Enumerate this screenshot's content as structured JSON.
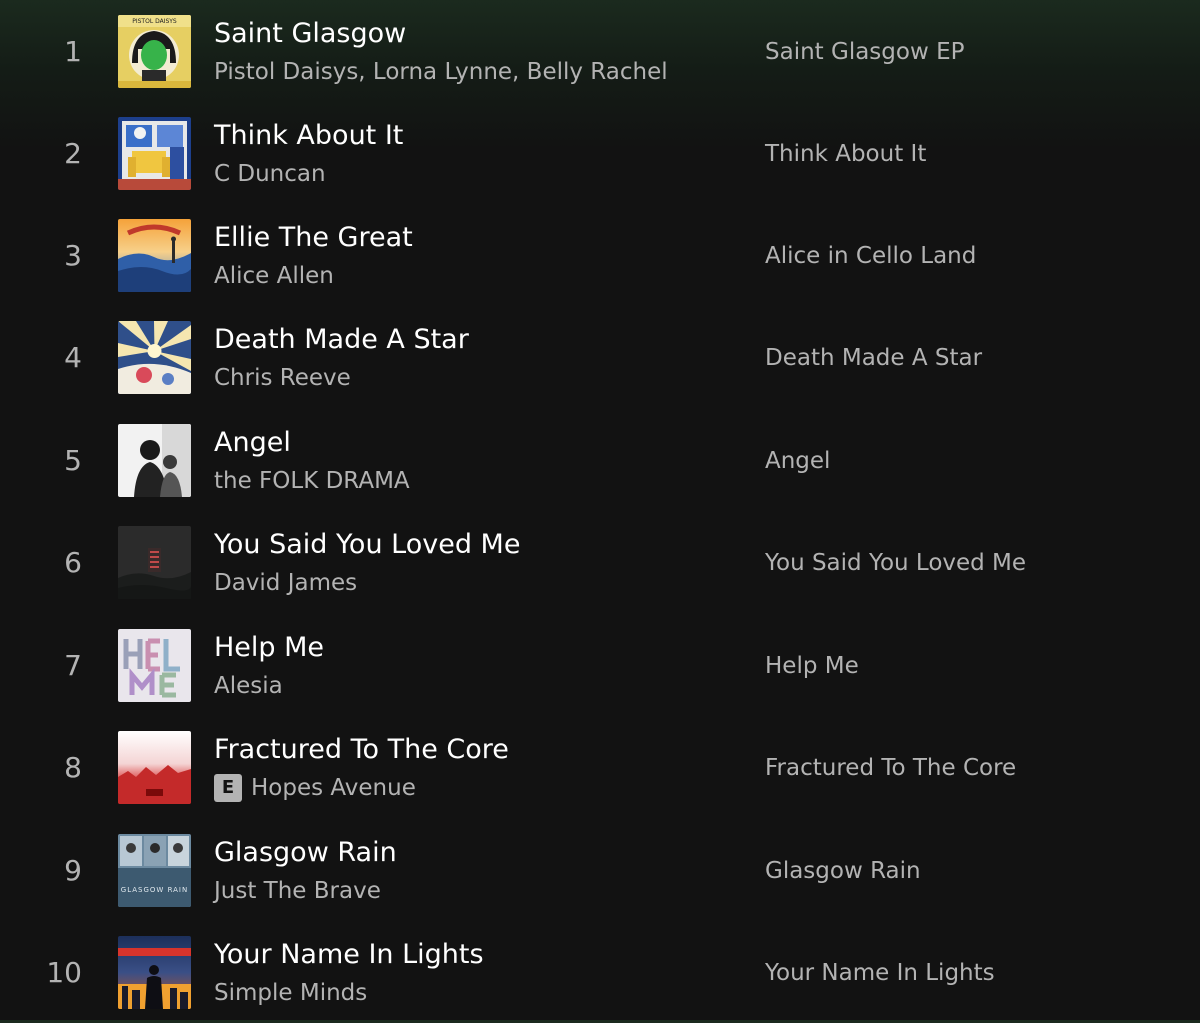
{
  "tracks": [
    {
      "number": "1",
      "title": "Saint Glasgow",
      "artists": "Pistol Daisys, Lorna Lynne, Belly Rachel",
      "album": "Saint Glasgow EP",
      "explicit": false,
      "cover_text": "PISTOL DAISYS"
    },
    {
      "number": "2",
      "title": "Think About It",
      "artists": "C Duncan",
      "album": "Think About It",
      "explicit": false
    },
    {
      "number": "3",
      "title": "Ellie The Great",
      "artists": "Alice Allen",
      "album": "Alice in Cello Land",
      "explicit": false
    },
    {
      "number": "4",
      "title": "Death Made A Star",
      "artists": "Chris Reeve",
      "album": "Death Made A Star",
      "explicit": false
    },
    {
      "number": "5",
      "title": "Angel",
      "artists": "the FOLK DRAMA",
      "album": "Angel",
      "explicit": false
    },
    {
      "number": "6",
      "title": "You Said You Loved Me",
      "artists": "David James",
      "album": "You Said You Loved Me",
      "explicit": false
    },
    {
      "number": "7",
      "title": "Help Me",
      "artists": "Alesia",
      "album": "Help Me",
      "explicit": false
    },
    {
      "number": "8",
      "title": "Fractured To The Core",
      "artists": "Hopes Avenue",
      "album": "Fractured To The Core",
      "explicit": true,
      "explicit_label": "E"
    },
    {
      "number": "9",
      "title": "Glasgow Rain",
      "artists": "Just The Brave",
      "album": "Glasgow Rain",
      "explicit": false,
      "cover_text": "GLASGOW RAIN"
    },
    {
      "number": "10",
      "title": "Your Name In Lights",
      "artists": "Simple Minds",
      "album": "Your Name In Lights",
      "explicit": false
    }
  ],
  "colors": {
    "background": "#121212",
    "header_tint": "#1b2a1e",
    "primary_text": "#ffffff",
    "secondary_text": "#b3b3b3"
  }
}
